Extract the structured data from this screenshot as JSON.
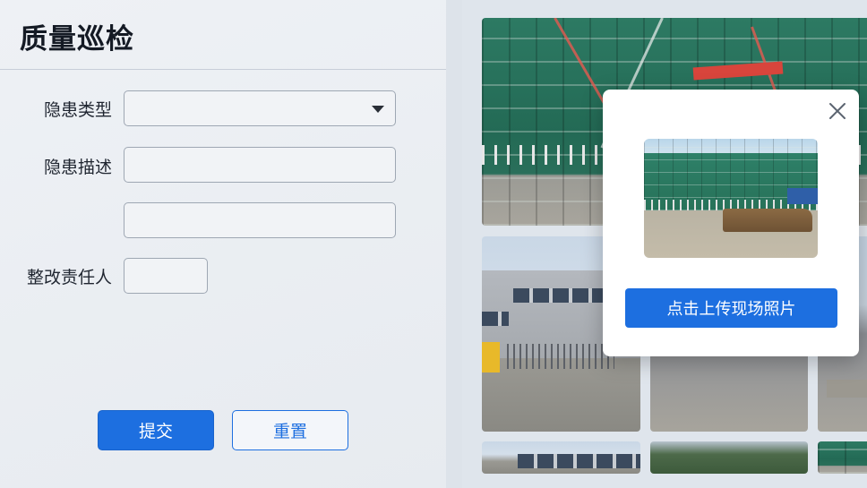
{
  "form": {
    "title": "质量巡检",
    "fields": {
      "hazard_type_label": "隐患类型",
      "hazard_type_value": "",
      "hazard_desc_label": "隐患描述",
      "hazard_desc_value": "",
      "hazard_desc_extra_value": "",
      "rectifier_label": "整改责任人",
      "rectifier_value": ""
    },
    "submit_label": "提交",
    "reset_label": "重置"
  },
  "modal": {
    "upload_label": "点击上传现场照片"
  },
  "colors": {
    "primary": "#1d6fe0",
    "panel_bg": "#eef1f5"
  },
  "icons": [
    "chevron-down-icon",
    "close-icon"
  ]
}
